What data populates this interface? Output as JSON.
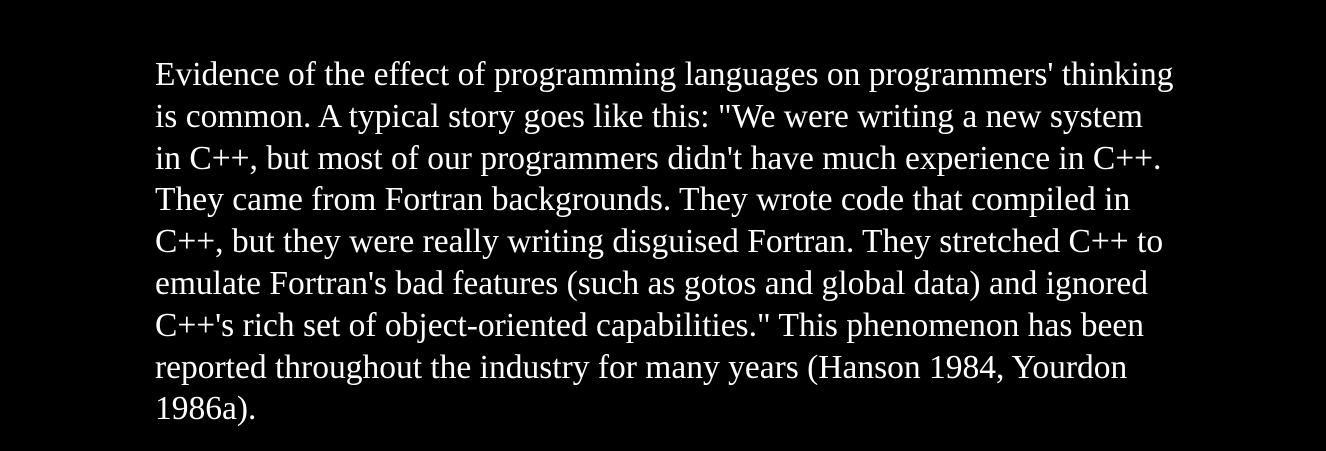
{
  "text_color": "#ffffff",
  "background_color": "#000000",
  "passage": {
    "lines": [
      "Evidence of the effect of programming languages on programmers' thinking",
      "is common. A typical story goes like this: \"We were writing a new system",
      "in C++, but most of our programmers didn't have much experience in C++.",
      "They came from Fortran backgrounds. They wrote code that compiled in",
      "C++, but they were really writing disguised Fortran. They stretched C++ to",
      "emulate Fortran's bad features (such as gotos and global data) and ignored",
      "C++'s rich set of object-oriented capabilities.\" This phenomenon has been",
      "reported throughout the industry for many years (Hanson 1984, Yourdon",
      "1986a)."
    ]
  }
}
